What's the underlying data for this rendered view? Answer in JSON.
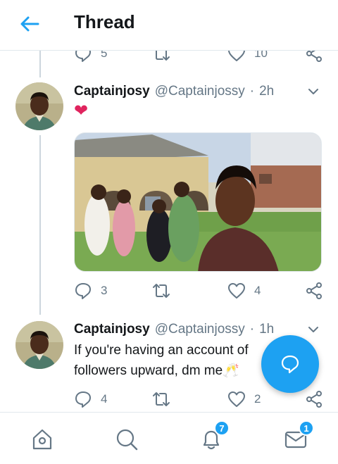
{
  "header": {
    "title": "Thread",
    "back_icon": "arrow-left-icon"
  },
  "tweets": [
    {
      "stats": {
        "replies": "5",
        "retweets": "",
        "likes": "10"
      }
    },
    {
      "name": "Captainjosy",
      "handle": "@Captainjossy",
      "time": "2h",
      "text": "❤",
      "has_photo": true,
      "stats": {
        "replies": "3",
        "retweets": "",
        "likes": "4"
      }
    },
    {
      "name": "Captainjosy",
      "handle": "@Captainjossy",
      "time": "1h",
      "text_line1": "If you're having an account of",
      "text_line2": "followers upward, dm me🥂",
      "stats": {
        "replies": "4",
        "retweets": "",
        "likes": "2"
      }
    }
  ],
  "separator": "·",
  "fab": {
    "icon": "compose-message-icon"
  },
  "bottom_nav": {
    "items": [
      {
        "name": "home",
        "icon": "home-icon",
        "badge": ""
      },
      {
        "name": "search",
        "icon": "search-icon",
        "badge": ""
      },
      {
        "name": "notifications",
        "icon": "bell-icon",
        "badge": "7"
      },
      {
        "name": "messages",
        "icon": "mail-icon",
        "badge": "1"
      }
    ]
  },
  "colors": {
    "accent": "#1da1f2",
    "text": "#14171a",
    "secondary": "#657786",
    "heart": "#e0245e",
    "divider": "#e1e8ed"
  }
}
